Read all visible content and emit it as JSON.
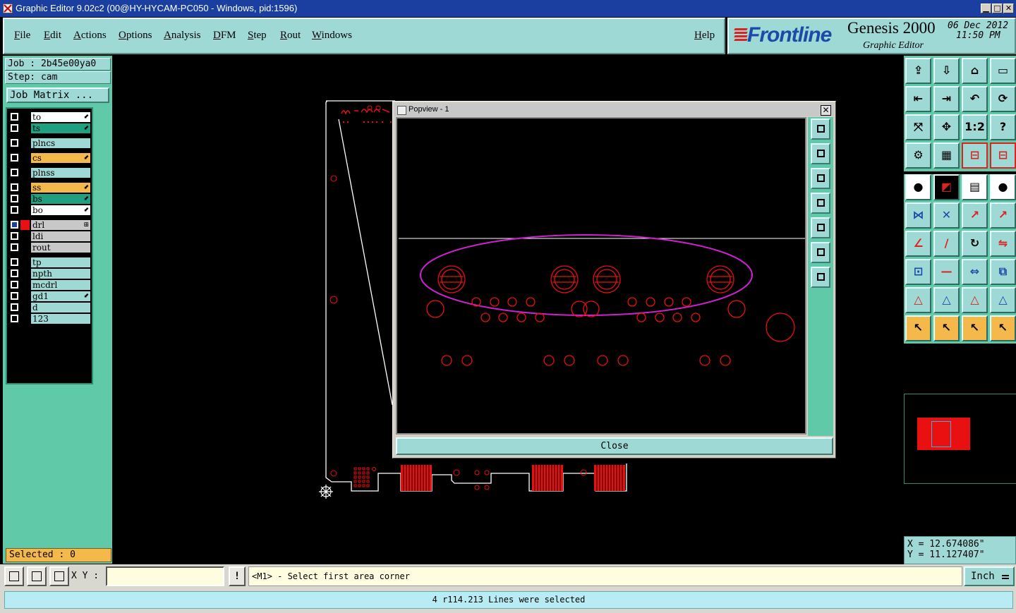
{
  "window": {
    "title": "Graphic Editor 9.02c2 (00@HY-HYCAM-PC050 - Windows, pid:1596)",
    "minimize": "▁",
    "maximize": "□",
    "close": "✕"
  },
  "menu": [
    "File",
    "Edit",
    "Actions",
    "Options",
    "Analysis",
    "DFM",
    "Step",
    "Rout",
    "Windows"
  ],
  "help": "Help",
  "brand": {
    "logo": "Frontline",
    "product": "Genesis 2000",
    "subtitle": "Graphic Editor",
    "date": "06 Dec 2012",
    "time": "11:50 PM"
  },
  "job": {
    "job_line": "Job : 2b45e00ya0",
    "step_line": "Step: cam",
    "matrix_button": "Job Matrix ..."
  },
  "layers": [
    {
      "name": "to",
      "color": "#ffffff",
      "flag": "⬋"
    },
    {
      "name": "ts",
      "color": "#20a080",
      "flag": "⬋"
    },
    {
      "name": "plncs",
      "color": "#9fd9d6",
      "flag": ""
    },
    {
      "name": "cs",
      "color": "#f5b84a",
      "flag": "⬋"
    },
    {
      "name": "plnss",
      "color": "#9fd9d6",
      "flag": ""
    },
    {
      "name": "ss",
      "color": "#f5b84a",
      "flag": "⬋"
    },
    {
      "name": "bs",
      "color": "#20a080",
      "flag": "⬋"
    },
    {
      "name": "bo",
      "color": "#ffffff",
      "flag": "⬋"
    },
    {
      "name": "drl",
      "color": "#c8c8c8",
      "flag": "⊞"
    },
    {
      "name": "ldi",
      "color": "#c8c8c8",
      "flag": ""
    },
    {
      "name": "rout",
      "color": "#c8c8c8",
      "flag": ""
    },
    {
      "name": "tp",
      "color": "#9fd9d6",
      "flag": ""
    },
    {
      "name": "npth",
      "color": "#9fd9d6",
      "flag": ""
    },
    {
      "name": "mcdrl",
      "color": "#9fd9d6",
      "flag": ""
    },
    {
      "name": "gd1",
      "color": "#9fd9d6",
      "flag": "⬋"
    },
    {
      "name": "d",
      "color": "#9fd9d6",
      "flag": ""
    },
    {
      "name": "123",
      "color": "#9fd9d6",
      "flag": ""
    }
  ],
  "selected": "Selected : 0",
  "popview": {
    "title": "Popview - 1",
    "close_x": "✕",
    "close_button": "Close"
  },
  "right_tools": [
    "zoom-home-icon",
    "zoom-in-icon",
    "reset-view-icon",
    "zoom-window-icon",
    "pan-left-icon",
    "pan-right-icon",
    "undo-zoom-icon",
    "redraw-icon",
    "fit-all-icon",
    "center-icon",
    "one-to-one-icon",
    "help-icon",
    "snap-icon",
    "grid-icon",
    "layer-compare-icon",
    "layer-select-icon",
    "add-pad-icon",
    "add-line-icon",
    "measure-icon",
    "add-circle-icon",
    "connect-icon",
    "delete-icon",
    "move-icon",
    "copy-icon",
    "angle-line-icon",
    "edit-line-icon",
    "rotate-icon",
    "mirror-icon",
    "resize-icon",
    "split-icon",
    "stretch-icon",
    "transform-icon",
    "filter-1-icon",
    "filter-2-icon",
    "filter-3-icon",
    "filter-4-icon",
    "pointer-select-icon",
    "pointer-area-icon",
    "pointer-feature-icon",
    "pointer-net-icon"
  ],
  "coords": {
    "x": "X = 12.674086\"",
    "y": "Y = 11.127407\""
  },
  "bottom": {
    "xy_label": "X Y :",
    "xy_value": "",
    "warn": "!",
    "prompt": "<M1> - Select first area corner",
    "units": "Inch"
  },
  "status": "4 r114.213 Lines were selected",
  "colors": {
    "accent": "#9fd9d6",
    "panel": "#5fc9a8",
    "feature": "#e81010",
    "highlight": "#d020d0"
  }
}
